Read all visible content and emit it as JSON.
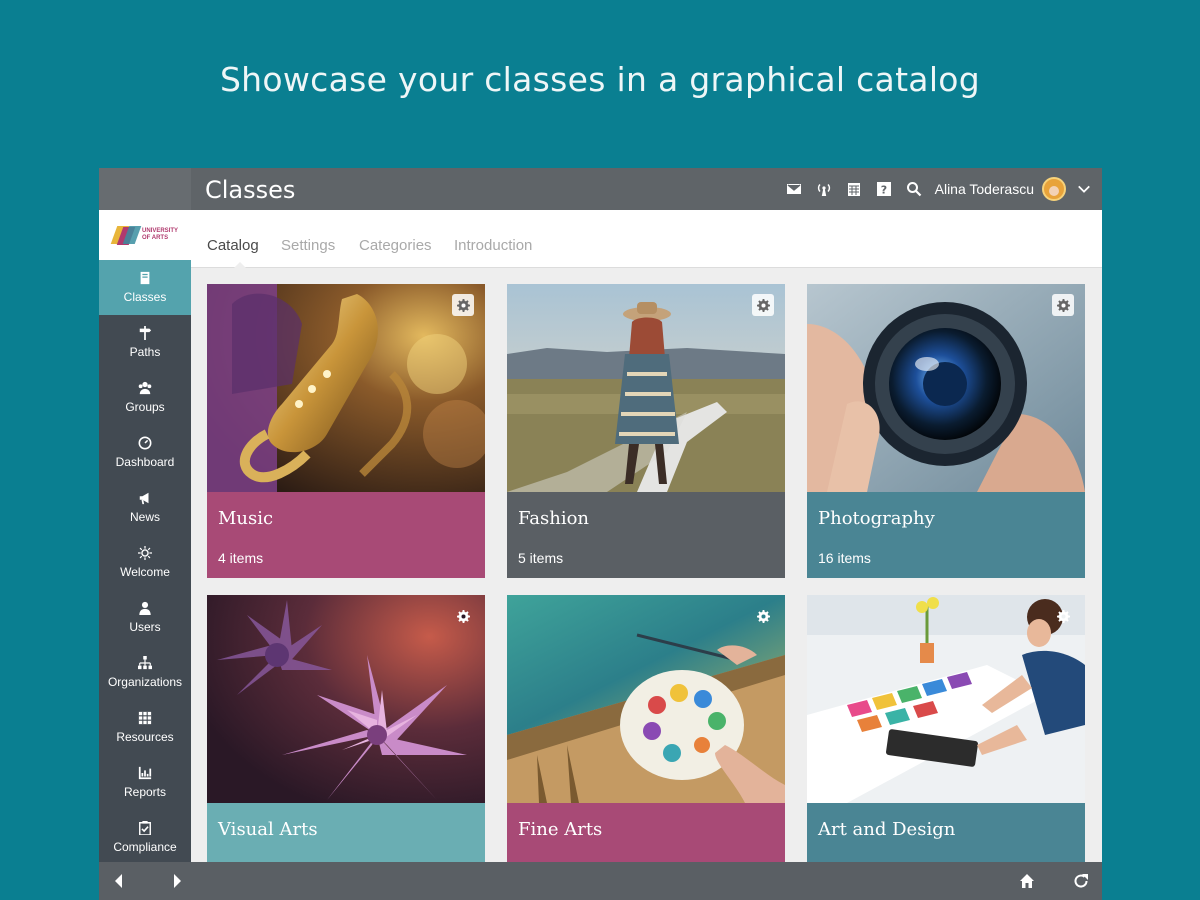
{
  "headline": "Showcase your classes in a graphical catalog",
  "app": {
    "title": "Classes"
  },
  "header": {
    "user_name": "Alina Toderascu",
    "icons": [
      "mail-icon",
      "broadcast-icon",
      "calendar-icon",
      "help-icon",
      "search-icon"
    ]
  },
  "logo": {
    "line1": "UNIVERSITY",
    "line2": "OF ARTS"
  },
  "sidebar": {
    "items": [
      {
        "label": "Classes",
        "icon": "book-icon",
        "active": true
      },
      {
        "label": "Paths",
        "icon": "signpost-icon",
        "active": false
      },
      {
        "label": "Groups",
        "icon": "groups-icon",
        "active": false
      },
      {
        "label": "Dashboard",
        "icon": "dashboard-icon",
        "active": false
      },
      {
        "label": "News",
        "icon": "megaphone-icon",
        "active": false
      },
      {
        "label": "Welcome",
        "icon": "sun-icon",
        "active": false
      },
      {
        "label": "Users",
        "icon": "user-icon",
        "active": false
      },
      {
        "label": "Organizations",
        "icon": "org-chart-icon",
        "active": false
      },
      {
        "label": "Resources",
        "icon": "grid-icon",
        "active": false
      },
      {
        "label": "Reports",
        "icon": "chart-icon",
        "active": false
      },
      {
        "label": "Compliance",
        "icon": "clipboard-check-icon",
        "active": false
      }
    ]
  },
  "tabs": [
    {
      "label": "Catalog",
      "active": true
    },
    {
      "label": "Settings",
      "active": false
    },
    {
      "label": "Categories",
      "active": false
    },
    {
      "label": "Introduction",
      "active": false
    }
  ],
  "cards": [
    {
      "title": "Music",
      "count": "4 items",
      "color": "#a84a76"
    },
    {
      "title": "Fashion",
      "count": "5 items",
      "color": "#5a5f64"
    },
    {
      "title": "Photography",
      "count": "16 items",
      "color": "#4a8594"
    },
    {
      "title": "Visual Arts",
      "count": "",
      "color": "#6aaeb3"
    },
    {
      "title": "Fine Arts",
      "count": "",
      "color": "#a84a76"
    },
    {
      "title": "Art and Design",
      "count": "",
      "color": "#4a8594"
    }
  ],
  "colors": {
    "background": "#0a7f91",
    "topbar": "#5f6468",
    "sidebar": "#424a52",
    "sidebar_active": "#54a3ad"
  }
}
